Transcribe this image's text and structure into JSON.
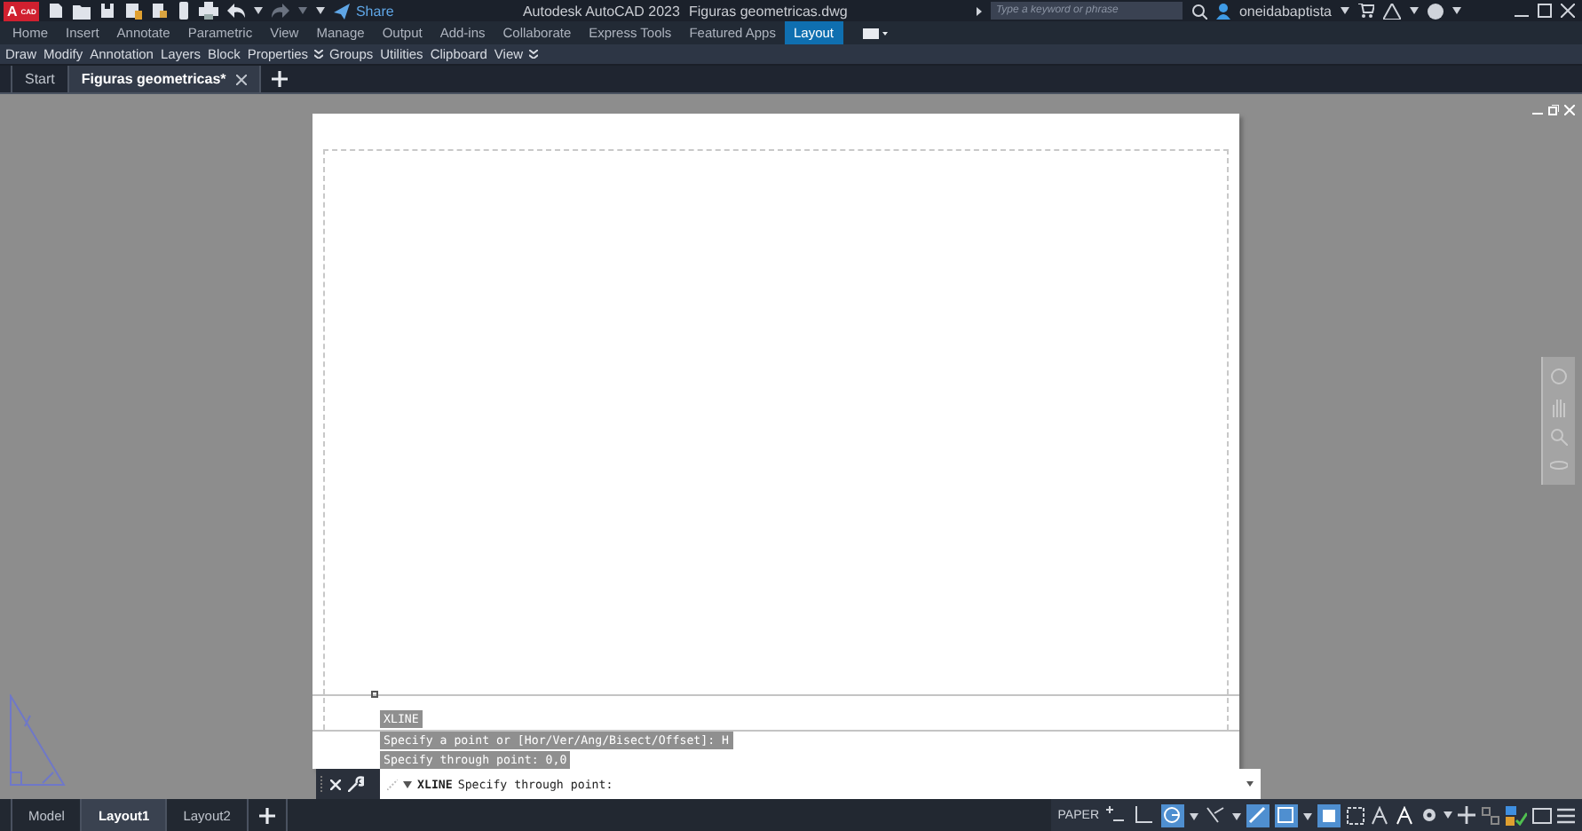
{
  "titlebar": {
    "logo": "A",
    "logo_badge": "CAD",
    "share": "Share",
    "app_name": "Autodesk AutoCAD 2023",
    "file_name": "Figuras geometricas.dwg",
    "search": {
      "placeholder": "Type a keyword or phrase"
    },
    "user": "oneidabaptista"
  },
  "ribbon_tabs": [
    {
      "label": "Home",
      "selected": false
    },
    {
      "label": "Insert",
      "selected": false
    },
    {
      "label": "Annotate",
      "selected": false
    },
    {
      "label": "Parametric",
      "selected": false
    },
    {
      "label": "View",
      "selected": false
    },
    {
      "label": "Manage",
      "selected": false
    },
    {
      "label": "Output",
      "selected": false
    },
    {
      "label": "Add-ins",
      "selected": false
    },
    {
      "label": "Collaborate",
      "selected": false
    },
    {
      "label": "Express Tools",
      "selected": false
    },
    {
      "label": "Featured Apps",
      "selected": false
    },
    {
      "label": "Layout",
      "selected": true
    }
  ],
  "ribbon_panels": [
    {
      "label": "Draw",
      "has_menu": false
    },
    {
      "label": "Modify",
      "has_menu": false
    },
    {
      "label": "Annotation",
      "has_menu": false
    },
    {
      "label": "Layers",
      "has_menu": false
    },
    {
      "label": "Block",
      "has_menu": false
    },
    {
      "label": "Properties",
      "has_menu": true
    },
    {
      "label": "Groups",
      "has_menu": false
    },
    {
      "label": "Utilities",
      "has_menu": false
    },
    {
      "label": "Clipboard",
      "has_menu": false
    },
    {
      "label": "View",
      "has_menu": true
    }
  ],
  "doc_tabs": [
    {
      "label": "Start",
      "selected": false
    },
    {
      "label": "Figuras geometricas*",
      "selected": true
    }
  ],
  "command_history": [
    "XLINE",
    "Specify a point or [Hor/Ver/Ang/Bisect/Offset]: H",
    "Specify through point: 0,0"
  ],
  "command_line": {
    "command": "XLINE",
    "prompt": "Specify through point:"
  },
  "layout_tabs": [
    {
      "label": "Model",
      "selected": false
    },
    {
      "label": "Layout1",
      "selected": true
    },
    {
      "label": "Layout2",
      "selected": false
    }
  ],
  "status_bar": {
    "space": "PAPER",
    "toggles": [
      {
        "kind": "snap",
        "on": false,
        "has_menu": false
      },
      {
        "kind": "ortho",
        "on": false,
        "has_menu": false
      },
      {
        "kind": "polar",
        "on": true,
        "has_menu": true
      },
      {
        "kind": "tracking",
        "on": false,
        "has_menu": true
      },
      {
        "kind": "lineweight",
        "on": true,
        "has_menu": false
      },
      {
        "kind": "selection",
        "on": true,
        "has_menu": true
      },
      {
        "kind": "transparency",
        "on": true,
        "has_menu": false
      }
    ]
  }
}
